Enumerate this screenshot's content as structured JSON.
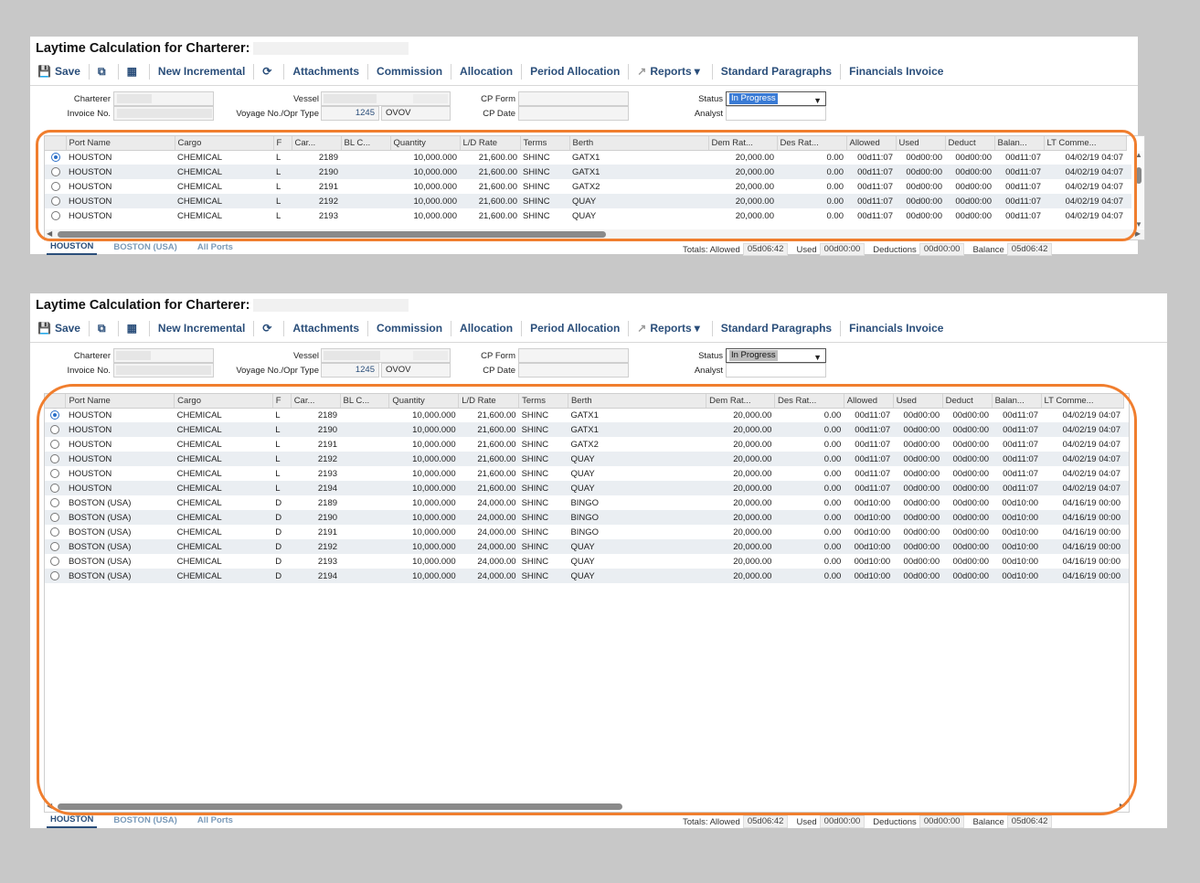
{
  "title": "Laytime Calculation for Charterer:",
  "toolbar": {
    "save": "Save",
    "new_incremental": "New Incremental",
    "attachments": "Attachments",
    "commission": "Commission",
    "allocation": "Allocation",
    "period_allocation": "Period Allocation",
    "reports": "Reports",
    "standard_paragraphs": "Standard Paragraphs",
    "financials_invoice": "Financials Invoice"
  },
  "fields": {
    "charterer_label": "Charterer",
    "invoice_label": "Invoice No.",
    "vessel_label": "Vessel",
    "voyage_label": "Voyage No./Opr Type",
    "voyage_no": "1245",
    "opr_type": "OVOV",
    "cp_form_label": "CP Form",
    "cp_date_label": "CP Date",
    "status_label": "Status",
    "status_value": "In Progress",
    "analyst_label": "Analyst"
  },
  "columns": [
    "Port Name",
    "Cargo",
    "F",
    "Car...",
    "BL C...",
    "Quantity",
    "L/D Rate",
    "Terms",
    "Berth",
    "Dem Rat...",
    "Des Rat...",
    "Allowed",
    "Used",
    "Deduct",
    "Balan...",
    "LT Comme..."
  ],
  "rows": [
    {
      "port": "HOUSTON",
      "cargo": "CHEMICAL",
      "f": "L",
      "car": "2189",
      "qty": "10,000.000",
      "rate": "21,600.00",
      "terms": "SHINC",
      "berth": "GATX1",
      "dem": "20,000.00",
      "des": "0.00",
      "allowed": "00d11:07",
      "used": "00d00:00",
      "deduct": "00d00:00",
      "balance": "00d11:07",
      "lt": "04/02/19 04:07"
    },
    {
      "port": "HOUSTON",
      "cargo": "CHEMICAL",
      "f": "L",
      "car": "2190",
      "qty": "10,000.000",
      "rate": "21,600.00",
      "terms": "SHINC",
      "berth": "GATX1",
      "dem": "20,000.00",
      "des": "0.00",
      "allowed": "00d11:07",
      "used": "00d00:00",
      "deduct": "00d00:00",
      "balance": "00d11:07",
      "lt": "04/02/19 04:07"
    },
    {
      "port": "HOUSTON",
      "cargo": "CHEMICAL",
      "f": "L",
      "car": "2191",
      "qty": "10,000.000",
      "rate": "21,600.00",
      "terms": "SHINC",
      "berth": "GATX2",
      "dem": "20,000.00",
      "des": "0.00",
      "allowed": "00d11:07",
      "used": "00d00:00",
      "deduct": "00d00:00",
      "balance": "00d11:07",
      "lt": "04/02/19 04:07"
    },
    {
      "port": "HOUSTON",
      "cargo": "CHEMICAL",
      "f": "L",
      "car": "2192",
      "qty": "10,000.000",
      "rate": "21,600.00",
      "terms": "SHINC",
      "berth": "QUAY",
      "dem": "20,000.00",
      "des": "0.00",
      "allowed": "00d11:07",
      "used": "00d00:00",
      "deduct": "00d00:00",
      "balance": "00d11:07",
      "lt": "04/02/19 04:07"
    },
    {
      "port": "HOUSTON",
      "cargo": "CHEMICAL",
      "f": "L",
      "car": "2193",
      "qty": "10,000.000",
      "rate": "21,600.00",
      "terms": "SHINC",
      "berth": "QUAY",
      "dem": "20,000.00",
      "des": "0.00",
      "allowed": "00d11:07",
      "used": "00d00:00",
      "deduct": "00d00:00",
      "balance": "00d11:07",
      "lt": "04/02/19 04:07"
    },
    {
      "port": "HOUSTON",
      "cargo": "CHEMICAL",
      "f": "L",
      "car": "2194",
      "qty": "10,000.000",
      "rate": "21,600.00",
      "terms": "SHINC",
      "berth": "QUAY",
      "dem": "20,000.00",
      "des": "0.00",
      "allowed": "00d11:07",
      "used": "00d00:00",
      "deduct": "00d00:00",
      "balance": "00d11:07",
      "lt": "04/02/19 04:07"
    },
    {
      "port": "BOSTON (USA)",
      "cargo": "CHEMICAL",
      "f": "D",
      "car": "2189",
      "qty": "10,000.000",
      "rate": "24,000.00",
      "terms": "SHINC",
      "berth": "BINGO",
      "dem": "20,000.00",
      "des": "0.00",
      "allowed": "00d10:00",
      "used": "00d00:00",
      "deduct": "00d00:00",
      "balance": "00d10:00",
      "lt": "04/16/19 00:00"
    },
    {
      "port": "BOSTON (USA)",
      "cargo": "CHEMICAL",
      "f": "D",
      "car": "2190",
      "qty": "10,000.000",
      "rate": "24,000.00",
      "terms": "SHINC",
      "berth": "BINGO",
      "dem": "20,000.00",
      "des": "0.00",
      "allowed": "00d10:00",
      "used": "00d00:00",
      "deduct": "00d00:00",
      "balance": "00d10:00",
      "lt": "04/16/19 00:00"
    },
    {
      "port": "BOSTON (USA)",
      "cargo": "CHEMICAL",
      "f": "D",
      "car": "2191",
      "qty": "10,000.000",
      "rate": "24,000.00",
      "terms": "SHINC",
      "berth": "BINGO",
      "dem": "20,000.00",
      "des": "0.00",
      "allowed": "00d10:00",
      "used": "00d00:00",
      "deduct": "00d00:00",
      "balance": "00d10:00",
      "lt": "04/16/19 00:00"
    },
    {
      "port": "BOSTON (USA)",
      "cargo": "CHEMICAL",
      "f": "D",
      "car": "2192",
      "qty": "10,000.000",
      "rate": "24,000.00",
      "terms": "SHINC",
      "berth": "QUAY",
      "dem": "20,000.00",
      "des": "0.00",
      "allowed": "00d10:00",
      "used": "00d00:00",
      "deduct": "00d00:00",
      "balance": "00d10:00",
      "lt": "04/16/19 00:00"
    },
    {
      "port": "BOSTON (USA)",
      "cargo": "CHEMICAL",
      "f": "D",
      "car": "2193",
      "qty": "10,000.000",
      "rate": "24,000.00",
      "terms": "SHINC",
      "berth": "QUAY",
      "dem": "20,000.00",
      "des": "0.00",
      "allowed": "00d10:00",
      "used": "00d00:00",
      "deduct": "00d00:00",
      "balance": "00d10:00",
      "lt": "04/16/19 00:00"
    },
    {
      "port": "BOSTON (USA)",
      "cargo": "CHEMICAL",
      "f": "D",
      "car": "2194",
      "qty": "10,000.000",
      "rate": "24,000.00",
      "terms": "SHINC",
      "berth": "QUAY",
      "dem": "20,000.00",
      "des": "0.00",
      "allowed": "00d10:00",
      "used": "00d00:00",
      "deduct": "00d00:00",
      "balance": "00d10:00",
      "lt": "04/16/19 00:00"
    }
  ],
  "panel1_visible_rows": 5,
  "tabs": [
    "HOUSTON",
    "BOSTON (USA)",
    "All Ports"
  ],
  "totals": {
    "allowed_label": "Totals: Allowed",
    "allowed": "05d06:42",
    "used_label": "Used",
    "used": "00d00:00",
    "deductions_label": "Deductions",
    "deductions": "00d00:00",
    "balance_label": "Balance",
    "balance": "05d06:42"
  },
  "colors": {
    "accent": "#2a4e7a",
    "callout": "#f07e2e",
    "row_alt": "#eaeef2"
  }
}
